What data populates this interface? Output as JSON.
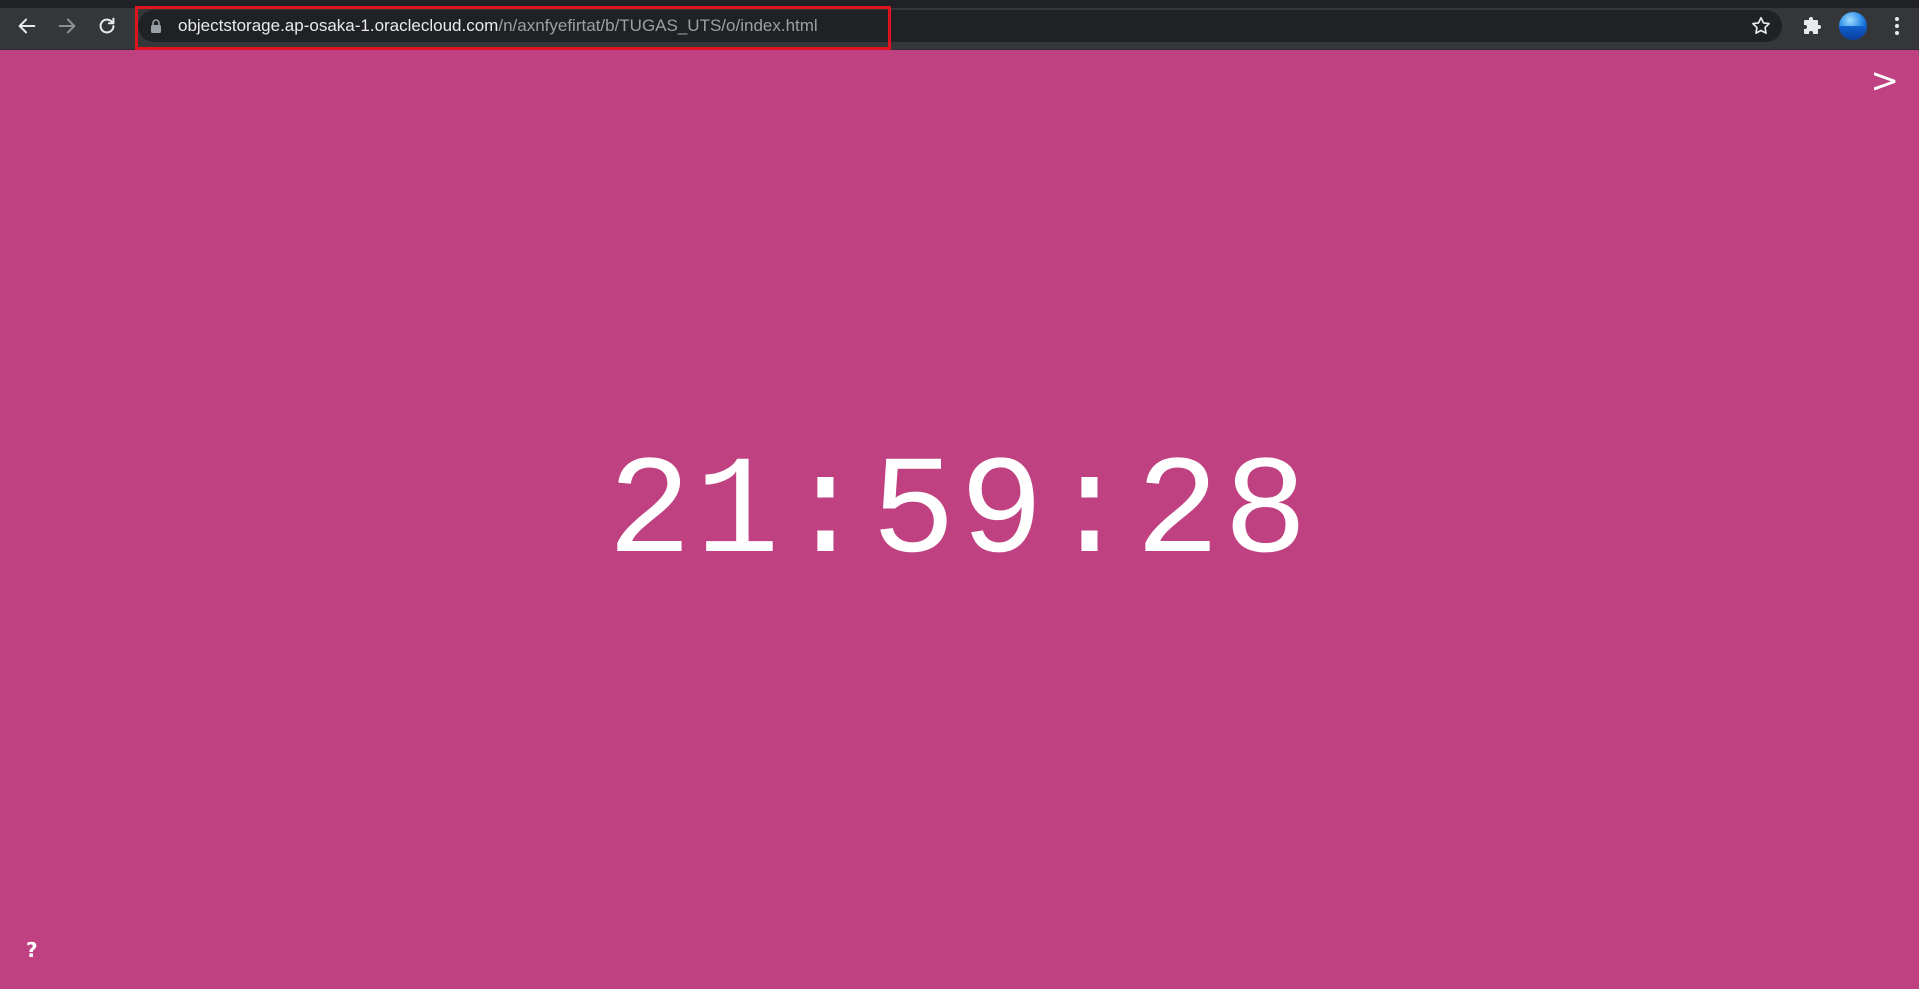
{
  "browser": {
    "url_host": "objectstorage.ap-osaka-1.oraclecloud.com",
    "url_path": "/n/axnfyefirtat/b/TUGAS_UTS/o/index.html",
    "icons": {
      "back": "arrow-left-icon",
      "forward": "arrow-right-icon",
      "reload": "reload-icon",
      "lock": "lock-icon",
      "bookmark": "star-icon",
      "extensions": "puzzle-icon",
      "profile": "avatar",
      "menu": "kebab-menu-icon"
    }
  },
  "page": {
    "time": "21:59:28",
    "next_label": ">",
    "help_label": "?",
    "colors": {
      "background": "#c04181",
      "text": "#ffffff"
    }
  }
}
